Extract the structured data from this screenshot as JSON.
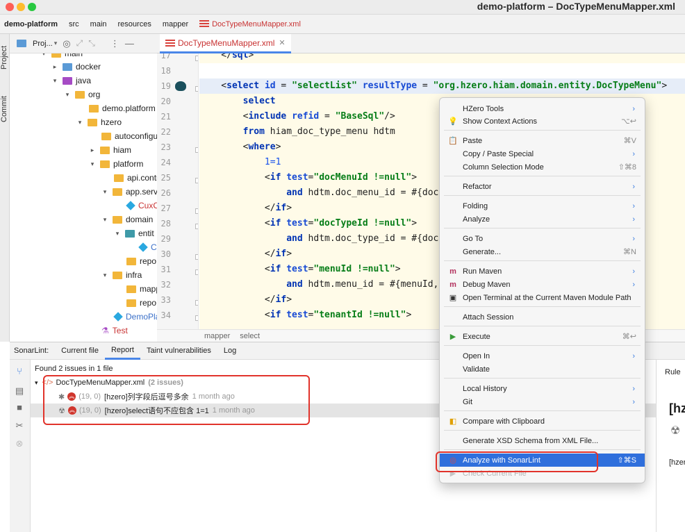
{
  "window": {
    "title": "demo-platform – DocTypeMenuMapper.xml"
  },
  "navbar": {
    "items": [
      "demo-platform",
      "src",
      "main",
      "resources",
      "mapper",
      "DocTypeMenuMapper.xml"
    ]
  },
  "sidebar": {
    "project_tab": "Project",
    "commit_tab": "Commit"
  },
  "project_panel": {
    "title": "Proj..."
  },
  "tree": [
    {
      "label": "main"
    },
    {
      "label": "docker"
    },
    {
      "label": "java"
    },
    {
      "label": "org"
    },
    {
      "label": "demo.platform"
    },
    {
      "label": "hzero"
    },
    {
      "label": "autoconfigu"
    },
    {
      "label": "hiam"
    },
    {
      "label": "platform"
    },
    {
      "label": "api.contr"
    },
    {
      "label": "app.serv"
    },
    {
      "label": "CuxC"
    },
    {
      "label": "domain"
    },
    {
      "label": "entit"
    },
    {
      "label": "C"
    },
    {
      "label": "repo"
    },
    {
      "label": "infra"
    },
    {
      "label": "mapp"
    },
    {
      "label": "repo"
    },
    {
      "label": "DemoPla"
    },
    {
      "label": "Test"
    }
  ],
  "editor": {
    "tab": "DocTypeMenuMapper.xml",
    "line_numbers": [
      "17",
      "18",
      "19",
      "20",
      "21",
      "22",
      "23",
      "24",
      "25",
      "26",
      "27",
      "28",
      "29",
      "30",
      "31",
      "32",
      "33",
      "34"
    ],
    "lines": [
      "    </sql>",
      "",
      "    <select id = \"selectList\" resultType = \"org.hzero.hiam.domain.entity.DocTypeMenu\">",
      "        select",
      "        <include refid = \"BaseSql\"/>",
      "        from hiam_doc_type_menu hdtm",
      "        <where>",
      "            1=1",
      "            <if test=\"docMenuId !=null\">",
      "                and hdtm.doc_menu_id = #{doc",
      "            </if>",
      "            <if test=\"docTypeId !=null\">",
      "                and hdtm.doc_type_id = #{doc",
      "            </if>",
      "            <if test=\"menuId !=null\">",
      "                and hdtm.menu_id = #{menuId,",
      "            </if>",
      "            <if test=\"tenantId !=null\">"
    ],
    "breadcrumb": [
      "mapper",
      "select"
    ]
  },
  "sonarlint": {
    "label": "SonarLint:",
    "tabs": [
      "Current file",
      "Report",
      "Taint vulnerabilities",
      "Log"
    ],
    "summary": "Found 2 issues in 1 file",
    "file": {
      "name": "DocTypeMenuMapper.xml",
      "count": "(2 issues)"
    },
    "issues": [
      {
        "pos": "(19, 0)",
        "msg": "[hzero]列字段后逗号多余",
        "age": "1 month ago"
      },
      {
        "pos": "(19, 0)",
        "msg": "[hzero]select语句不应包含 1=1",
        "age": "1 month ago"
      }
    ],
    "rule_tab": "Rule",
    "rule_heading": "[hz",
    "rule_text": "[hzer"
  },
  "context_menu": {
    "items": [
      {
        "label": "HZero Tools",
        "sub": true
      },
      {
        "label": "Show Context Actions",
        "shortcut": "⌥↩"
      },
      {
        "label": "Paste",
        "shortcut": "⌘V"
      },
      {
        "label": "Copy / Paste Special",
        "sub": true
      },
      {
        "label": "Column Selection Mode",
        "shortcut": "⇧⌘8"
      },
      {
        "label": "Refactor",
        "sub": true
      },
      {
        "label": "Folding",
        "sub": true
      },
      {
        "label": "Analyze",
        "sub": true
      },
      {
        "label": "Go To",
        "sub": true
      },
      {
        "label": "Generate...",
        "shortcut": "⌘N"
      },
      {
        "label": "Run Maven",
        "sub": true
      },
      {
        "label": "Debug Maven",
        "sub": true
      },
      {
        "label": "Open Terminal at the Current Maven Module Path"
      },
      {
        "label": "Attach Session"
      },
      {
        "label": "Execute",
        "shortcut": "⌘↩"
      },
      {
        "label": "Open In",
        "sub": true
      },
      {
        "label": "Validate"
      },
      {
        "label": "Local History",
        "sub": true
      },
      {
        "label": "Git",
        "sub": true
      },
      {
        "label": "Compare with Clipboard"
      },
      {
        "label": "Generate XSD Schema from XML File..."
      },
      {
        "label": "Analyze with SonarLint",
        "shortcut": "⇧⌘S"
      },
      {
        "label": "Check Current File"
      }
    ]
  },
  "colors": {
    "accent": "#2f6fdc",
    "highlight_box": "#e1332b",
    "code_bg": "#fffbe8"
  }
}
